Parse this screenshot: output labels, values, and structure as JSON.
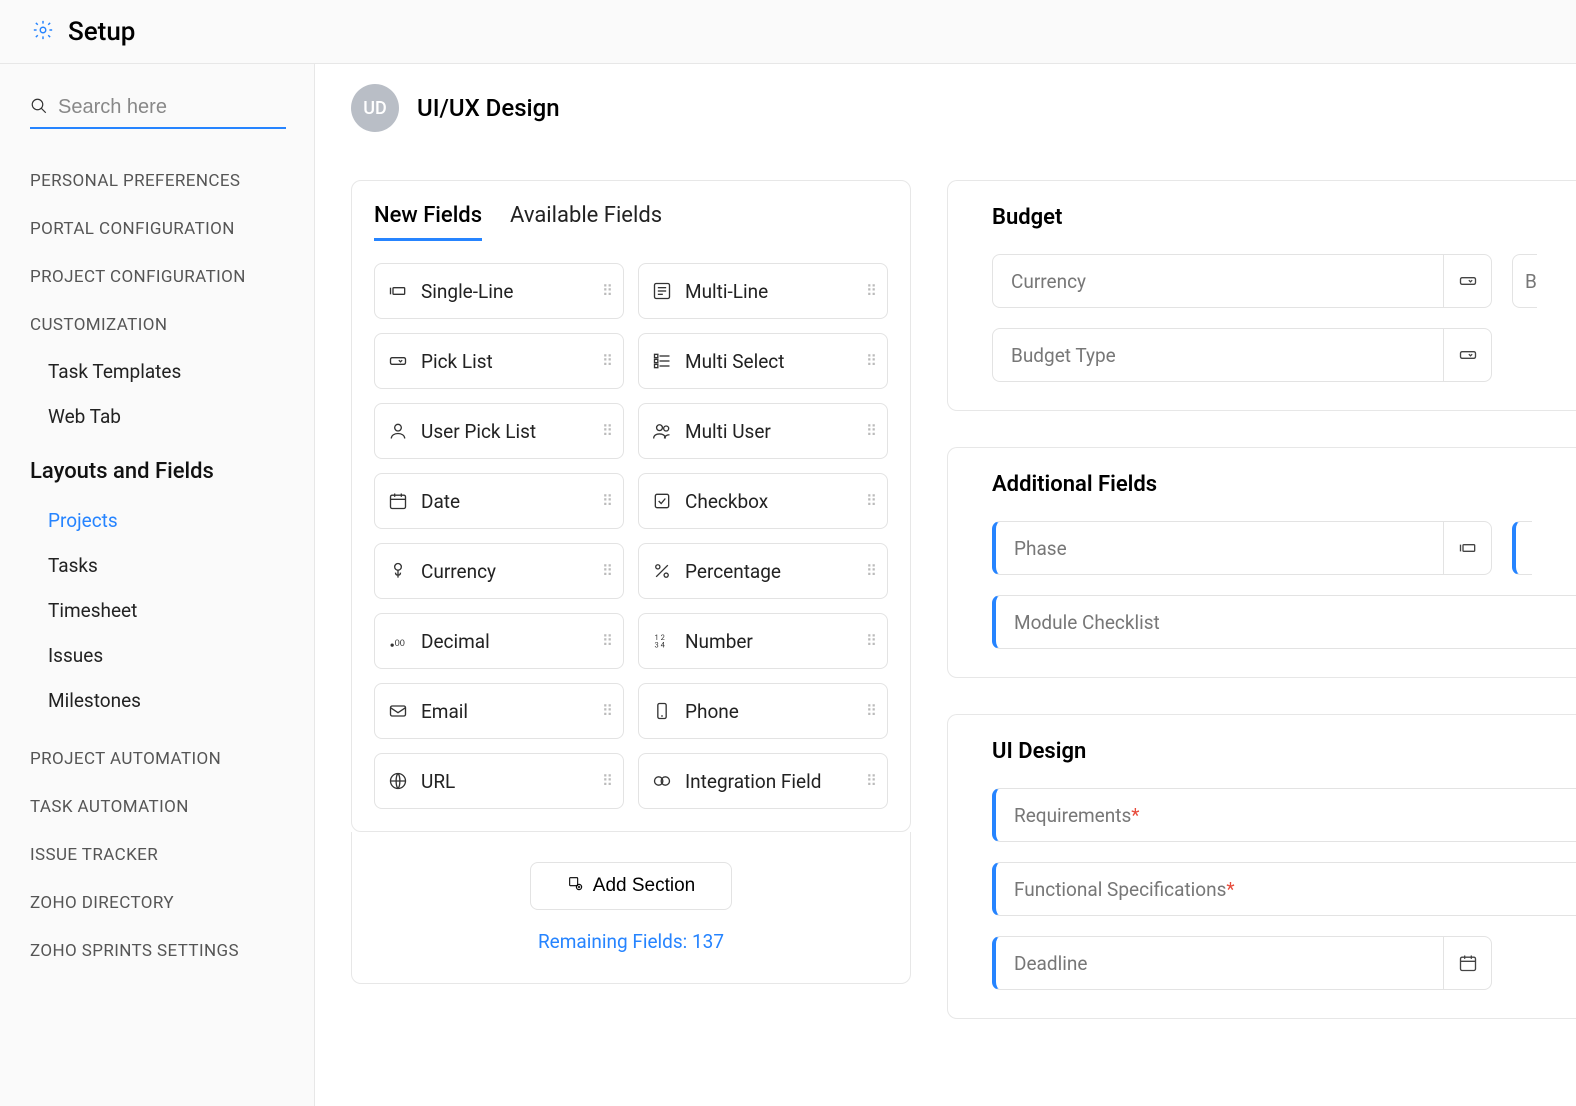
{
  "header": {
    "title": "Setup"
  },
  "sidebar": {
    "search_placeholder": "Search here",
    "groups": [
      "PERSONAL PREFERENCES",
      "PORTAL CONFIGURATION",
      "PROJECT CONFIGURATION",
      "CUSTOMIZATION"
    ],
    "customization_items": [
      "Task Templates",
      "Web Tab"
    ],
    "section_title": "Layouts and Fields",
    "layout_items": [
      "Projects",
      "Tasks",
      "Timesheet",
      "Issues",
      "Milestones"
    ],
    "tail_groups": [
      "PROJECT AUTOMATION",
      "TASK AUTOMATION",
      "ISSUE TRACKER",
      "ZOHO DIRECTORY",
      "ZOHO SPRINTS SETTINGS"
    ]
  },
  "page": {
    "avatar_initials": "UD",
    "title": "UI/UX Design"
  },
  "field_tabs": [
    "New Fields",
    "Available Fields"
  ],
  "new_fields": [
    {
      "label": "Single-Line",
      "icon": "single-line"
    },
    {
      "label": "Multi-Line",
      "icon": "multi-line"
    },
    {
      "label": "Pick List",
      "icon": "picklist"
    },
    {
      "label": "Multi Select",
      "icon": "multi-select"
    },
    {
      "label": "User Pick List",
      "icon": "user"
    },
    {
      "label": "Multi User",
      "icon": "users"
    },
    {
      "label": "Date",
      "icon": "date"
    },
    {
      "label": "Checkbox",
      "icon": "checkbox"
    },
    {
      "label": "Currency",
      "icon": "currency"
    },
    {
      "label": "Percentage",
      "icon": "percent"
    },
    {
      "label": "Decimal",
      "icon": "decimal"
    },
    {
      "label": "Number",
      "icon": "number"
    },
    {
      "label": "Email",
      "icon": "email"
    },
    {
      "label": "Phone",
      "icon": "phone"
    },
    {
      "label": "URL",
      "icon": "url"
    },
    {
      "label": "Integration Field",
      "icon": "integration"
    }
  ],
  "add_section_label": "Add Section",
  "remaining_label": "Remaining Fields: 137",
  "sections": {
    "budget": {
      "title": "Budget",
      "rows": [
        {
          "label": "Currency",
          "icon": "picklist",
          "partial": "B"
        },
        {
          "label": "Budget Type",
          "icon": "picklist"
        }
      ]
    },
    "additional": {
      "title": "Additional Fields",
      "rows": [
        {
          "label": "Phase",
          "icon": "single-line",
          "custom": true,
          "has_partial": true
        },
        {
          "label": "Module Checklist",
          "custom": true
        }
      ]
    },
    "ui_design": {
      "title": "UI Design",
      "rows": [
        {
          "label": "Requirements",
          "required": true,
          "custom": true
        },
        {
          "label": "Functional Specifications",
          "required": true,
          "custom": true
        },
        {
          "label": "Deadline",
          "icon_right": "date",
          "custom": true
        }
      ]
    }
  }
}
